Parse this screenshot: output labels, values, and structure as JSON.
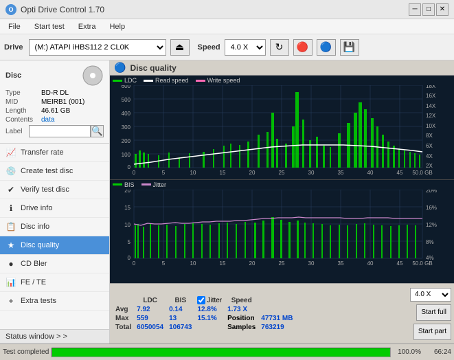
{
  "titleBar": {
    "icon": "O",
    "title": "Opti Drive Control 1.70",
    "minBtn": "─",
    "maxBtn": "□",
    "closeBtn": "✕"
  },
  "menuBar": {
    "items": [
      "File",
      "Start test",
      "Extra",
      "Help"
    ]
  },
  "toolbar": {
    "driveLabel": "Drive",
    "driveValue": "(M:)  ATAPI iHBS112  2 CL0K",
    "speedLabel": "Speed",
    "speedValue": "4.0 X"
  },
  "disc": {
    "label": "Disc",
    "typeLabel": "Type",
    "typeValue": "BD-R DL",
    "midLabel": "MID",
    "midValue": "MEIRB1 (001)",
    "lengthLabel": "Length",
    "lengthValue": "46.61 GB",
    "contentsLabel": "Contents",
    "contentsValue": "data",
    "labelLabel": "Label"
  },
  "navItems": [
    {
      "id": "transfer-rate",
      "label": "Transfer rate",
      "icon": "📈"
    },
    {
      "id": "create-test-disc",
      "label": "Create test disc",
      "icon": "💿"
    },
    {
      "id": "verify-test-disc",
      "label": "Verify test disc",
      "icon": "✔"
    },
    {
      "id": "drive-info",
      "label": "Drive info",
      "icon": "ℹ"
    },
    {
      "id": "disc-info",
      "label": "Disc info",
      "icon": "📋"
    },
    {
      "id": "disc-quality",
      "label": "Disc quality",
      "icon": "★",
      "active": true
    },
    {
      "id": "cd-bler",
      "label": "CD Bler",
      "icon": "🔵"
    },
    {
      "id": "fe-te",
      "label": "FE / TE",
      "icon": "📊"
    },
    {
      "id": "extra-tests",
      "label": "Extra tests",
      "icon": "+"
    }
  ],
  "statusWindow": {
    "label": "Status window  > >"
  },
  "chartHeader": {
    "title": "Disc quality"
  },
  "topChart": {
    "legend": [
      {
        "label": "LDC",
        "color": "#00cc00"
      },
      {
        "label": "Read speed",
        "color": "#ffffff"
      },
      {
        "label": "Write speed",
        "color": "#ff69b4"
      }
    ],
    "yAxisLeft": [
      "600",
      "500",
      "400",
      "300",
      "200",
      "100",
      "0"
    ],
    "yAxisRight": [
      "18X",
      "16X",
      "14X",
      "12X",
      "10X",
      "8X",
      "6X",
      "4X",
      "2X"
    ],
    "xAxis": [
      "0",
      "5",
      "10",
      "15",
      "20",
      "25",
      "30",
      "35",
      "40",
      "45",
      "50.0 GB"
    ]
  },
  "bottomChart": {
    "legend": [
      {
        "label": "BIS",
        "color": "#00cc00"
      },
      {
        "label": "Jitter",
        "color": "#cc88cc"
      }
    ],
    "yAxisLeft": [
      "20",
      "15",
      "10",
      "5",
      "0"
    ],
    "yAxisRight": [
      "20%",
      "16%",
      "12%",
      "8%",
      "4%"
    ],
    "xAxis": [
      "0",
      "5",
      "10",
      "15",
      "20",
      "25",
      "30",
      "35",
      "40",
      "45",
      "50.0 GB"
    ]
  },
  "stats": {
    "headers": [
      "",
      "LDC",
      "BIS",
      "",
      "Jitter",
      "Speed",
      "",
      ""
    ],
    "avg": {
      "label": "Avg",
      "ldc": "7.92",
      "bis": "0.14",
      "jitter": "12.8%",
      "speed": "1.73 X"
    },
    "max": {
      "label": "Max",
      "ldc": "559",
      "bis": "13",
      "jitter": "15.1%",
      "position": "47731 MB"
    },
    "total": {
      "label": "Total",
      "ldc": "6050054",
      "bis": "106743",
      "samples": "763219"
    },
    "positionLabel": "Position",
    "samplesLabel": "Samples",
    "jitterChecked": true,
    "speedDropdown": "4.0 X",
    "startFullBtn": "Start full",
    "startPartBtn": "Start part"
  },
  "progressBar": {
    "label": "Test completed",
    "percent": 100,
    "percentText": "100.0%",
    "time": "66:24"
  }
}
